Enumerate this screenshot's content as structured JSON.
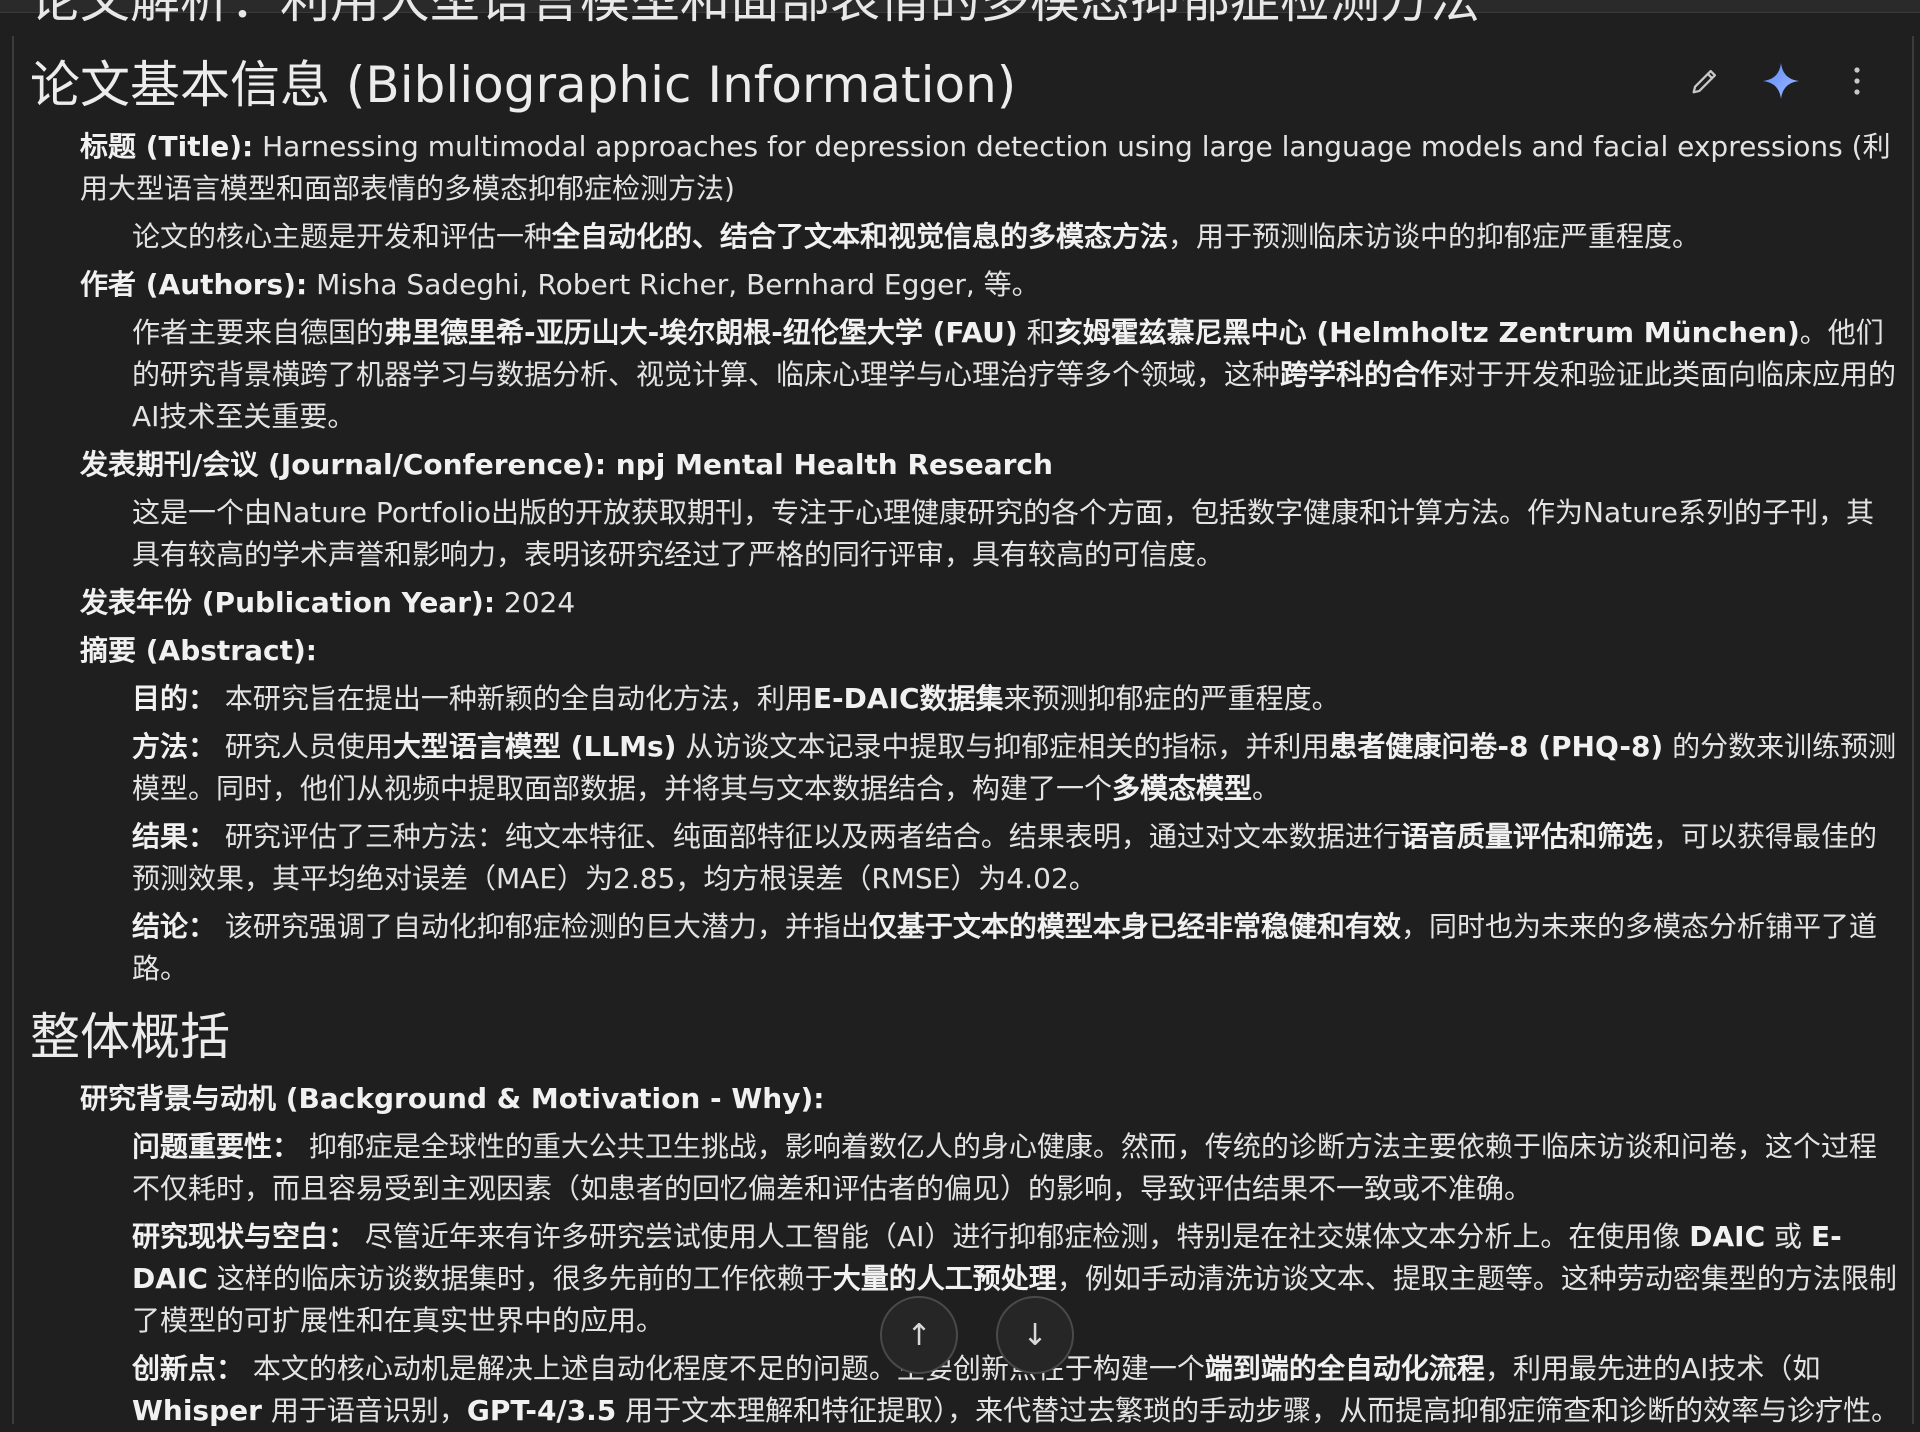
{
  "cut_heading": "论文解析：利用大型语言模型和面部表情的多模态抑郁症检测方法",
  "toolbar": {
    "edit_icon": "pencil-icon",
    "gemini_icon": "sparkle-icon",
    "more_icon": "more-vert-icon"
  },
  "sections": {
    "bib": {
      "heading": "论文基本信息 (Bibliographic Information)",
      "title": {
        "label": "标题 (Title):",
        "value": " Harnessing multimodal approaches for depression detection using large language models and facial expressions (利用大型语言模型和面部表情的多模态抑郁症检测方法)",
        "note_a": "论文的核心主题是开发和评估一种",
        "note_b": "全自动化的、结合了文本和视觉信息的多模态方法",
        "note_c": "，用于预测临床访谈中的抑郁症严重程度。"
      },
      "authors": {
        "label": "作者 (Authors):",
        "value": " Misha Sadeghi, Robert Richer, Bernhard Egger, 等。",
        "note_a": "作者主要来自德国的",
        "note_b": "弗里德里希-亚历山大-埃尔朗根-纽伦堡大学 (FAU)",
        "note_c": " 和",
        "note_d": "亥姆霍兹慕尼黑中心 (Helmholtz Zentrum München)",
        "note_e": "。他们的研究背景横跨了机器学习与数据分析、视觉计算、临床心理学与心理治疗等多个领域，这种",
        "note_f": "跨学科的合作",
        "note_g": "对于开发和验证此类面向临床应用的AI技术至关重要。"
      },
      "journal": {
        "label": "发表期刊/会议 (Journal/Conference): npj Mental Health Research",
        "note": "这是一个由Nature Portfolio出版的开放获取期刊，专注于心理健康研究的各个方面，包括数字健康和计算方法。作为Nature系列的子刊，其具有较高的学术声誉和影响力，表明该研究经过了严格的同行评审，具有较高的可信度。"
      },
      "year": {
        "label": "发表年份 (Publication Year):",
        "value": " 2024"
      },
      "abstract": {
        "label": "摘要 (Abstract):",
        "purpose_label": "目的：",
        "purpose_a": " 本研究旨在提出一种新颖的全自动化方法，利用",
        "purpose_b": "E-DAIC数据集",
        "purpose_c": "来预测抑郁症的严重程度。",
        "method_label": "方法：",
        "method_a": " 研究人员使用",
        "method_b": "大型语言模型 (LLMs)",
        "method_c": " 从访谈文本记录中提取与抑郁症相关的指标，并利用",
        "method_d": "患者健康问卷-8 (PHQ-8)",
        "method_e": " 的分数来训练预测模型。同时，他们从视频中提取面部数据，并将其与文本数据结合，构建了一个",
        "method_f": "多模态模型",
        "method_g": "。",
        "result_label": "结果：",
        "result_a": " 研究评估了三种方法：纯文本特征、纯面部特征以及两者结合。结果表明，通过对文本数据进行",
        "result_b": "语音质量评估和筛选",
        "result_c": "，可以获得最佳的预测效果，其平均绝对误差（MAE）为2.85，均方根误差（RMSE）为4.02。",
        "concl_label": "结论：",
        "concl_a": " 该研究强调了自动化抑郁症检测的巨大潜力，并指出",
        "concl_b": "仅基于文本的模型本身已经非常稳健和有效",
        "concl_c": "，同时也为未来的多模态分析铺平了道路。"
      }
    },
    "overview": {
      "heading": "整体概括",
      "bg_label": "研究背景与动机 (Background & Motivation - Why):",
      "imp_label": "问题重要性：",
      "imp_text": " 抑郁症是全球性的重大公共卫生挑战，影响着数亿人的身心健康。然而，传统的诊断方法主要依赖于临床访谈和问卷，这个过程不仅耗时，而且容易受到主观因素（如患者的回忆偏差和评估者的偏见）的影响，导致评估结果不一致或不准确。",
      "gap_label": "研究现状与空白：",
      "gap_a": " 尽管近年来有许多研究尝试使用人工智能（AI）进行抑郁症检测，特别是在社交媒体文本分析上。在使用像 ",
      "gap_b": "DAIC",
      "gap_c": " 或 ",
      "gap_d": "E-DAIC",
      "gap_e": " 这样的临床访谈数据集时，很多先前的工作依赖于",
      "gap_f": "大量的人工预处理",
      "gap_g": "，例如手动清洗访谈文本、提取主题等。这种劳动密集型的方法限制了模型的可扩展性和在真实世界中的应用。",
      "innov_label": "创新点：",
      "innov_a": " 本文的核心动机是解决上述自动化程度不足的问题。主要创新点在于构建一个",
      "innov_b": "端到端的全自动化流程",
      "innov_c": "，利用最先进的AI技术（如 ",
      "innov_d": "Whisper",
      "innov_e": " 用于语音识别，",
      "innov_f": "GPT-4/3.5",
      "innov_g": " 用于文本理解和特征提取），来代替过去繁琐的手动步骤，从而提高抑郁症筛查和诊断的效率与诊疗性。"
    }
  },
  "nav": {
    "up_icon": "arrow-up-icon",
    "down_icon": "arrow-down-icon",
    "up_glyph": "↑",
    "down_glyph": "↓"
  }
}
